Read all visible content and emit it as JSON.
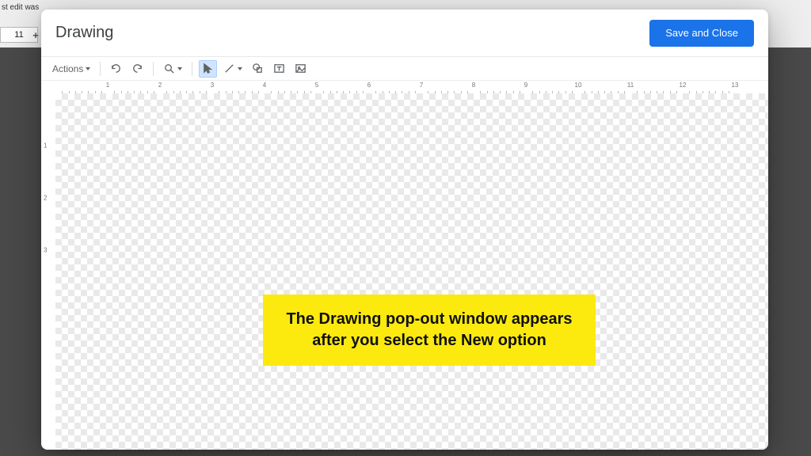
{
  "background": {
    "top_text": "st edit was ",
    "font_size": "11"
  },
  "dialog": {
    "title": "Drawing",
    "primary_button": "Save and Close"
  },
  "toolbar": {
    "actions_label": "Actions"
  },
  "ruler": {
    "h": [
      "1",
      "2",
      "3",
      "4",
      "5",
      "6",
      "7",
      "8",
      "9",
      "10",
      "11",
      "12",
      "13"
    ],
    "v": [
      "1",
      "2",
      "3"
    ]
  },
  "annotation": {
    "text": "The Drawing pop-out window appears after you select the New option"
  }
}
